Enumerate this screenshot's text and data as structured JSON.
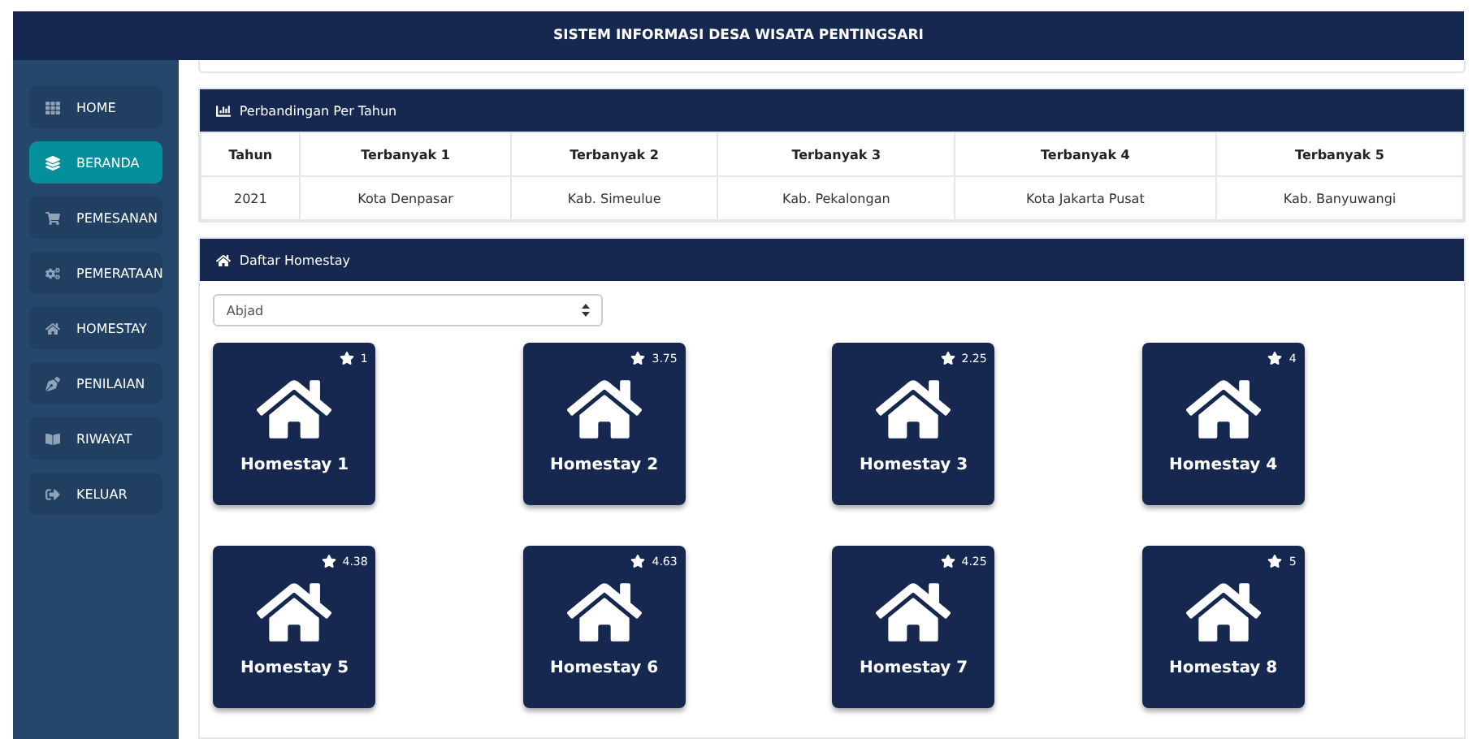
{
  "header": {
    "title": "SISTEM INFORMASI DESA WISATA PENTINGSARI"
  },
  "sidebar": {
    "items": [
      {
        "label": "HOME",
        "selected": false
      },
      {
        "label": "BERANDA",
        "selected": true
      },
      {
        "label": "PEMESANAN",
        "selected": false
      },
      {
        "label": "PEMERATAAN",
        "selected": false
      },
      {
        "label": "HOMESTAY",
        "selected": false
      },
      {
        "label": "PENILAIAN",
        "selected": false
      },
      {
        "label": "RIWAYAT",
        "selected": false
      },
      {
        "label": "KELUAR",
        "selected": false
      }
    ]
  },
  "comparison": {
    "title": "Perbandingan Per Tahun",
    "columns": [
      "Tahun",
      "Terbanyak 1",
      "Terbanyak 2",
      "Terbanyak 3",
      "Terbanyak 4",
      "Terbanyak 5"
    ],
    "rows": [
      [
        "2021",
        "Kota Denpasar",
        "Kab. Simeulue",
        "Kab. Pekalongan",
        "Kota Jakarta Pusat",
        "Kab. Banyuwangi"
      ]
    ]
  },
  "homestays": {
    "title": "Daftar Homestay",
    "sort": {
      "value": "Abjad"
    },
    "items": [
      {
        "name": "Homestay 1",
        "rating": "1"
      },
      {
        "name": "Homestay 2",
        "rating": "3.75"
      },
      {
        "name": "Homestay 3",
        "rating": "2.25"
      },
      {
        "name": "Homestay 4",
        "rating": "4"
      },
      {
        "name": "Homestay 5",
        "rating": "4.38"
      },
      {
        "name": "Homestay 6",
        "rating": "4.63"
      },
      {
        "name": "Homestay 7",
        "rating": "4.25"
      },
      {
        "name": "Homestay 8",
        "rating": "5"
      }
    ]
  }
}
